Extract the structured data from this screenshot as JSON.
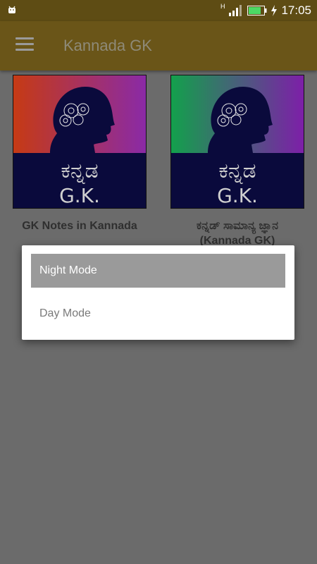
{
  "status_bar": {
    "network_label": "H",
    "time": "17:05"
  },
  "app_bar": {
    "title": "Kannada GK",
    "menu_icon": "hamburger-icon"
  },
  "cards": [
    {
      "image_text_top": "ಕನ್ನಡ",
      "image_text_bottom": "G.K.",
      "label": "GK Notes in Kannada",
      "bg_colors": [
        "#c63a14",
        "#8a2aa6"
      ]
    },
    {
      "image_text_top": "ಕನ್ನಡ",
      "image_text_bottom": "G.K.",
      "label": "ಕನ್ನಡ್ ಸಾಮಾನ್ಯ ಜ್ಞಾನ (Kannada GK)",
      "bg_colors": [
        "#13a04c",
        "#7d1fa8"
      ]
    }
  ],
  "dialog": {
    "options": [
      "Night Mode",
      "Day Mode"
    ],
    "selected": "Night Mode"
  },
  "colors": {
    "appbar": "#6a5518",
    "statusbar": "#5e4c14",
    "scrim_background": "#6b6b6b"
  }
}
